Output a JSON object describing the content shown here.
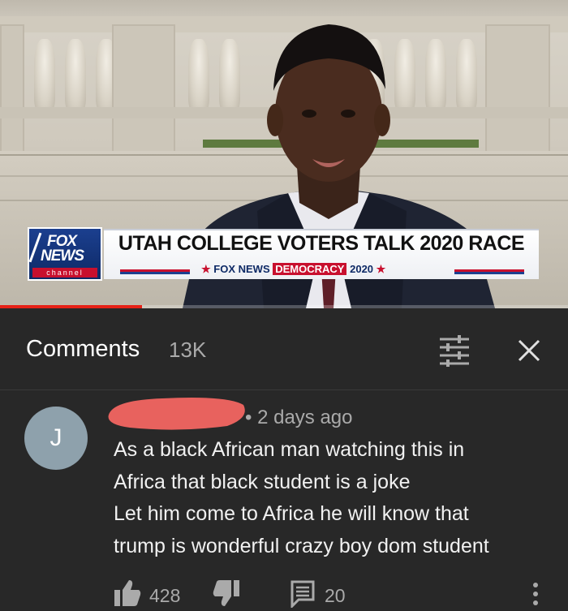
{
  "video": {
    "chyron_headline": "UTAH COLLEGE VOTERS TALK 2020 RACE",
    "chyron_sub_brand": "FOX NEWS",
    "chyron_sub_badge": "DEMOCRACY",
    "chyron_sub_year": "2020",
    "logo_line1": "FOX",
    "logo_line2": "NEWS",
    "logo_line3": "channel",
    "progress_fraction": 0.25
  },
  "comments_header": {
    "title": "Comments",
    "count": "13K",
    "sort_icon": "sort-filter-icon",
    "close_icon": "close-icon"
  },
  "comment": {
    "avatar_letter": "J",
    "username_redacted": true,
    "separator": "•",
    "time": "2 days ago",
    "lines": [
      "As a black African man watching this in",
      "Africa that black student is a joke",
      "Let him come  to Africa he will know that",
      "trump is wonderful crazy boy dom student"
    ],
    "likes": "428",
    "replies": "20",
    "icons": {
      "like": "thumbs-up-icon",
      "dislike": "thumbs-down-icon",
      "reply": "reply-icon",
      "more": "more-vert-icon"
    }
  },
  "colors": {
    "background": "#282828",
    "secondary_text": "#aaaaaa",
    "avatar_bg": "#8ea1ac",
    "redaction": "#e8625e",
    "progress": "#e62117"
  }
}
